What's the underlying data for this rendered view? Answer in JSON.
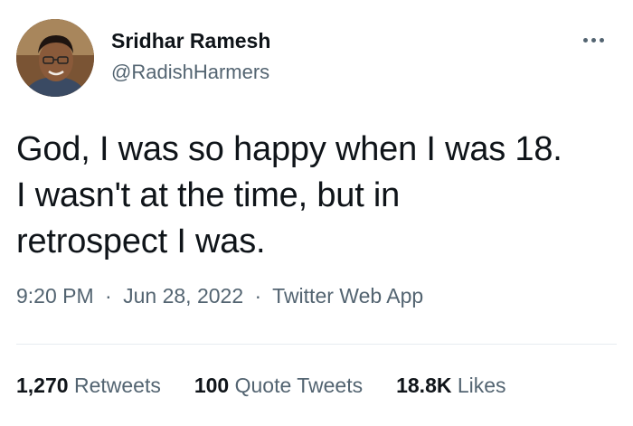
{
  "user": {
    "display_name": "Sridhar Ramesh",
    "handle": "@RadishHarmers"
  },
  "tweet": {
    "lines": [
      "God, I was so happy when I was 18.",
      "I wasn't at the time, but in",
      "retrospect I was."
    ]
  },
  "meta": {
    "time": "9:20 PM",
    "separator": "·",
    "date": "Jun 28, 2022",
    "source": "Twitter Web App"
  },
  "stats": {
    "retweets": {
      "count": "1,270",
      "label": "Retweets"
    },
    "quote_tweets": {
      "count": "100",
      "label": "Quote Tweets"
    },
    "likes": {
      "count": "18.8K",
      "label": "Likes"
    }
  },
  "icons": {
    "more": "more-horizontal-icon"
  },
  "colors": {
    "text_primary": "#0f1419",
    "text_secondary": "#536471",
    "divider": "#e6ecf0"
  }
}
